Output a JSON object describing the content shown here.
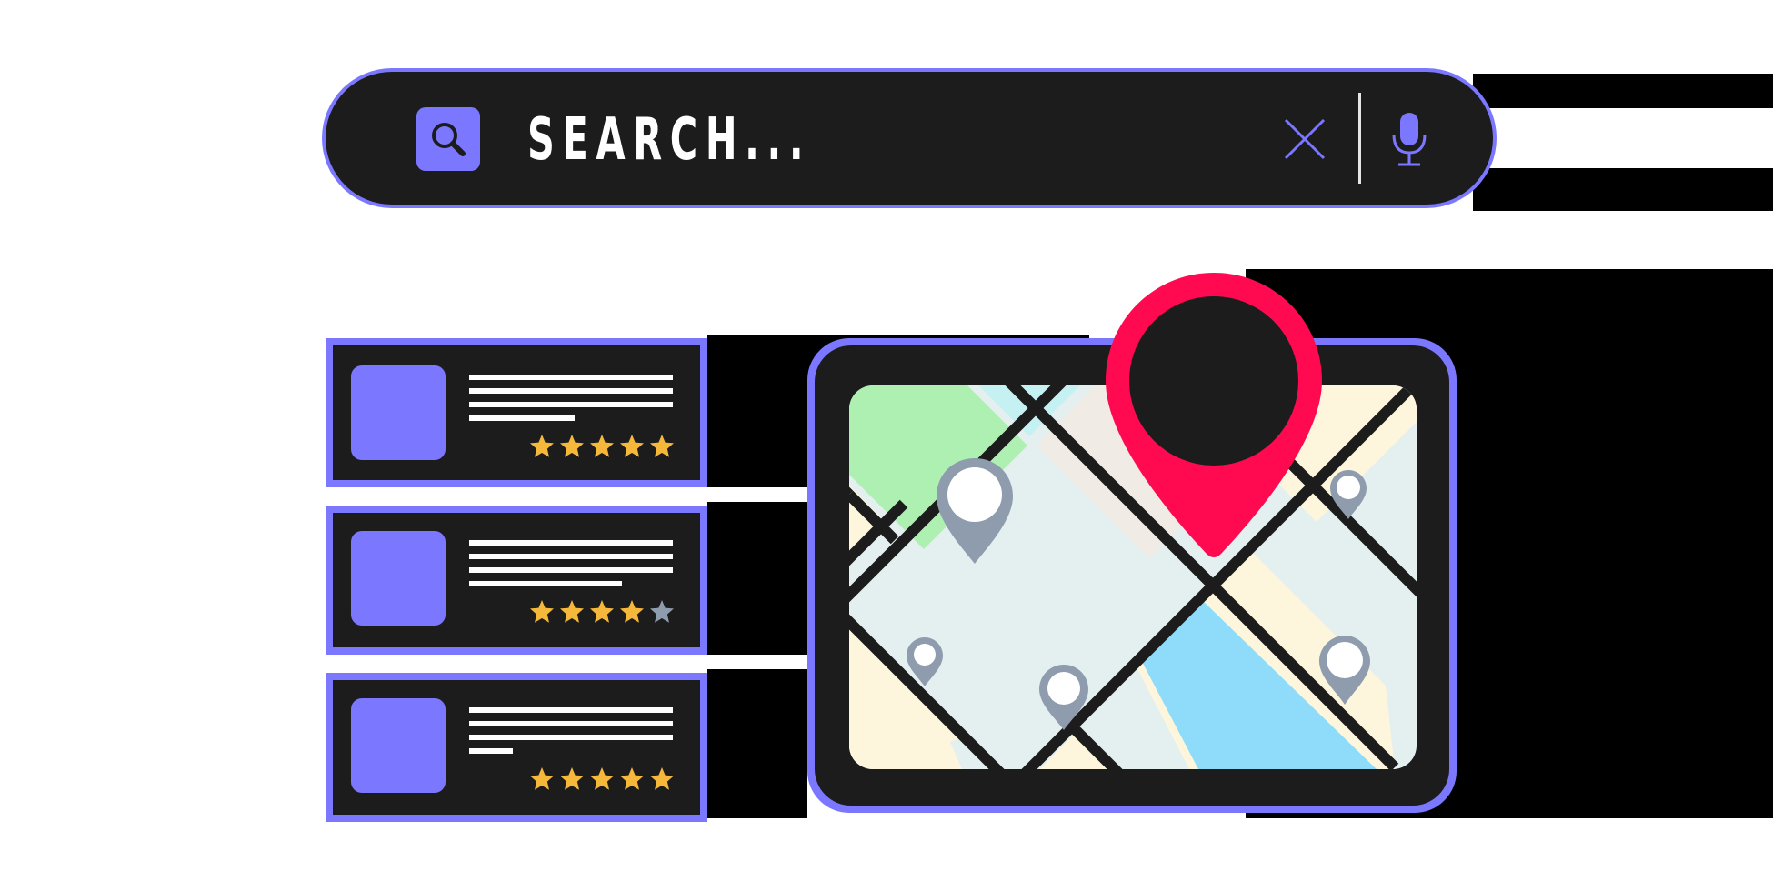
{
  "search": {
    "placeholder": "SEARCH...",
    "icon": "search-icon",
    "clear_icon": "close-icon",
    "mic_icon": "microphone-icon"
  },
  "listings": [
    {
      "rating": 5
    },
    {
      "rating": 4
    },
    {
      "rating": 5
    }
  ],
  "map": {
    "main_pin_icon": "location-pin-icon",
    "small_pin_icon": "map-marker-icon"
  },
  "colors": {
    "accent": "#7b78ff",
    "panel": "#1c1c1c",
    "pin_primary": "#ff0a50",
    "pin_secondary": "#8e9cad",
    "star_filled": "#f6b83b",
    "star_empty": "#8e9cad",
    "park": "#aef0b2",
    "water": "#8fdcfa",
    "road_area": "#e4eff0",
    "sand": "#fdf6dc"
  }
}
